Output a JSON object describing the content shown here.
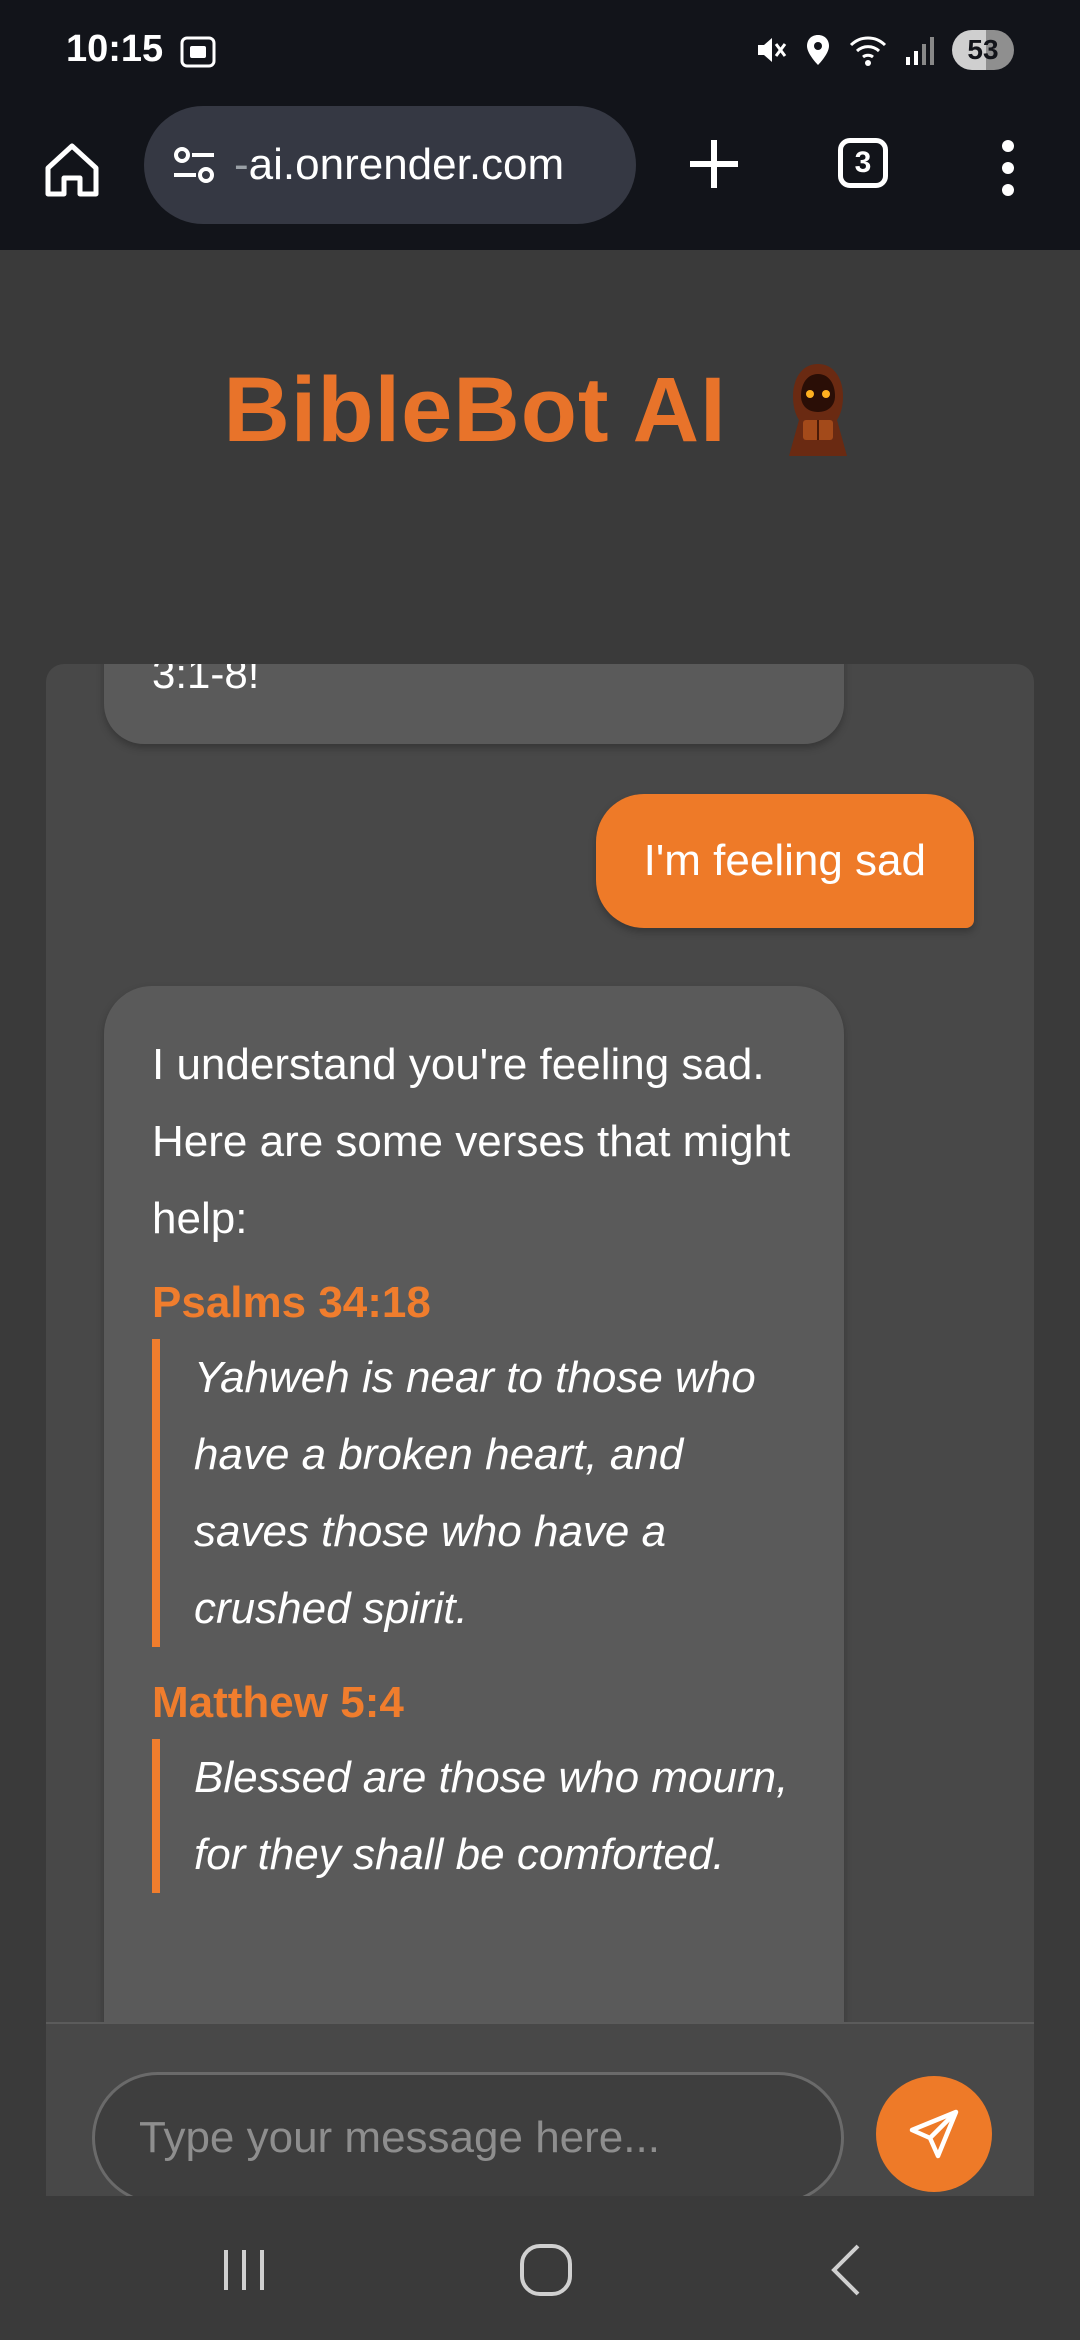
{
  "status_bar": {
    "time": "10:15",
    "battery": "53",
    "icons": [
      "screenshot-icon",
      "mute-icon",
      "location-icon",
      "wifi-icon",
      "signal-icon"
    ]
  },
  "browser": {
    "url_prefix": "-",
    "url": "ai.onrender.com",
    "tab_count": "3"
  },
  "app": {
    "title": "BibleBot AI",
    "accent_color": "#e8732a"
  },
  "chat": {
    "previous_bot_tail": "3:1-8!",
    "user_message": "I'm feeling sad",
    "bot_intro": "I understand you're feeling sad. Here are some verses that might help:",
    "verses": [
      {
        "ref": "Psalms 34:18",
        "lines": [
          "Yahweh is near to those who have a broken heart, and saves those who have a crushed spirit."
        ]
      },
      {
        "ref": "Matthew 5:4",
        "lines": [
          "Blessed are those who mourn,",
          "for they shall be comforted."
        ]
      }
    ]
  },
  "input": {
    "placeholder": "Type your message here..."
  }
}
